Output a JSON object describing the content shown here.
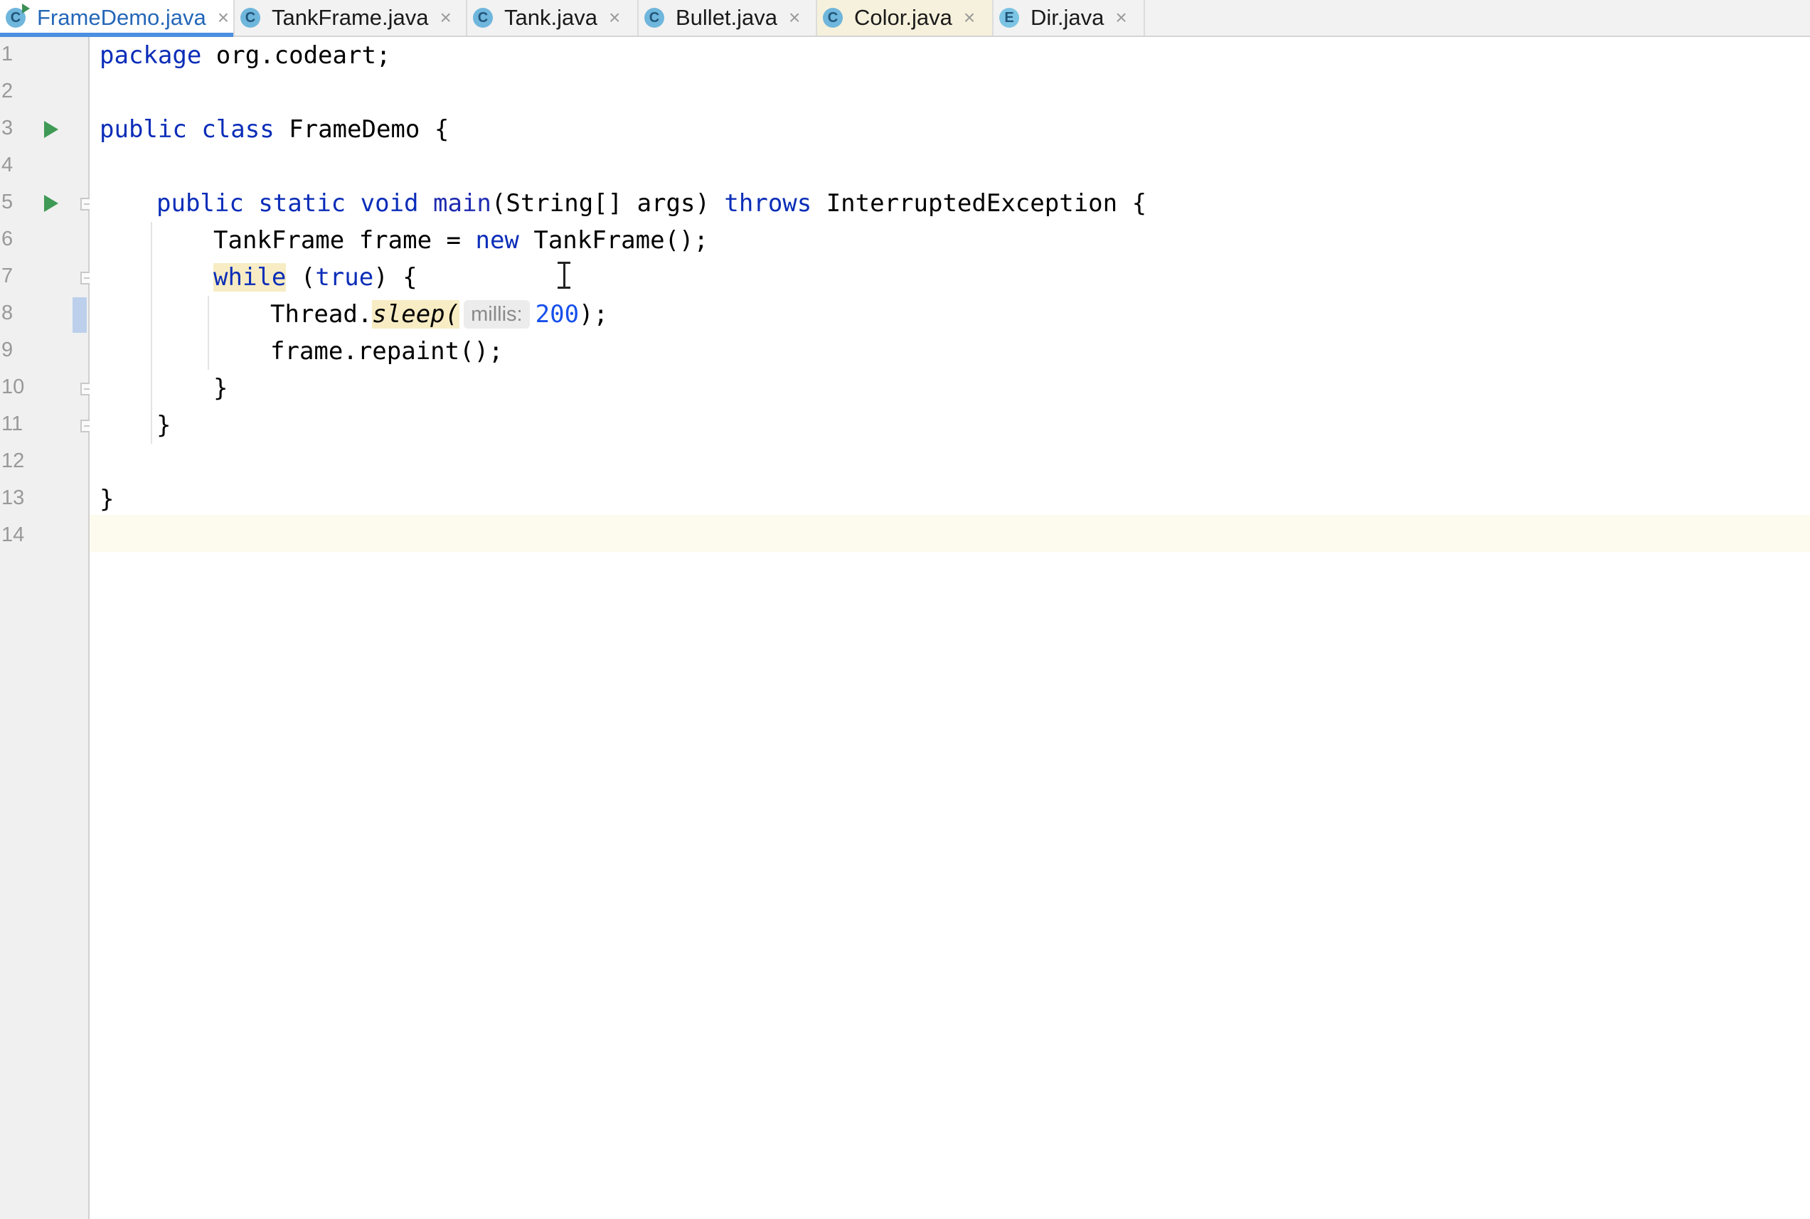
{
  "tabs": [
    {
      "label": "FrameDemo.java",
      "icon": "class-runnable-icon",
      "icon_letter": "C",
      "active": true
    },
    {
      "label": "TankFrame.java",
      "icon": "class-icon",
      "icon_letter": "C"
    },
    {
      "label": "Tank.java",
      "icon": "class-icon",
      "icon_letter": "C"
    },
    {
      "label": "Bullet.java",
      "icon": "class-icon",
      "icon_letter": "C"
    },
    {
      "label": "Color.java",
      "icon": "class-icon",
      "icon_letter": "C"
    },
    {
      "label": "Dir.java",
      "icon": "enum-icon",
      "icon_letter": "E"
    }
  ],
  "close_glyph": "×",
  "line_numbers": [
    "1",
    "2",
    "3",
    "4",
    "5",
    "6",
    "7",
    "8",
    "9",
    "10",
    "11",
    "12",
    "13",
    "14"
  ],
  "code": {
    "l1_kw": "package",
    "l1_rest": " org.codeart;",
    "l3_kw1": "public",
    "l3_kw2": "class",
    "l3_rest": " FrameDemo {",
    "l5_kw1": "public",
    "l5_kw2": "static",
    "l5_kw3": "void",
    "l5_fn": "main",
    "l5_mid": "(String[] args) ",
    "l5_kw4": "throws",
    "l5_rest": " InterruptedException {",
    "l6_a": "TankFrame frame = ",
    "l6_kw": "new",
    "l6_b": " TankFrame();",
    "l7_kw": "while",
    "l7_a": " (",
    "l7_kw2": "true",
    "l7_b": ") {",
    "l8_a": "Thread.",
    "l8_method": "sleep(",
    "l8_hint": "millis:",
    "l8_num": "200",
    "l8_b": ");",
    "l9": "frame.repaint();",
    "l10": "}",
    "l11": "}",
    "l13": "}"
  },
  "colors": {
    "keyword": "#0b2db8",
    "number": "#1750eb",
    "active_tab_text": "#2467b8",
    "run_icon": "#3e9a55"
  }
}
